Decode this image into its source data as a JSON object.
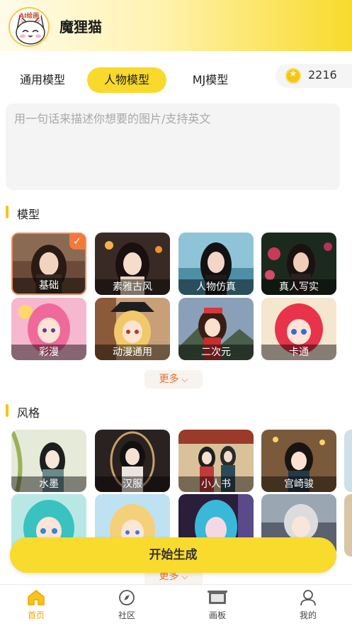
{
  "header": {
    "app_title": "魔狸猫",
    "logo_text": "AI绘画"
  },
  "tabs": [
    {
      "label": "通用模型",
      "active": false
    },
    {
      "label": "人物模型",
      "active": true
    },
    {
      "label": "MJ模型",
      "active": false
    }
  ],
  "coins": {
    "count": "2216"
  },
  "prompt": {
    "placeholder": "用一句话来描述你想要的图片/支持英文",
    "value": ""
  },
  "models_section": {
    "title": "模型",
    "items": [
      {
        "label": "基础",
        "selected": true
      },
      {
        "label": "素雅古风",
        "selected": false
      },
      {
        "label": "人物仿真",
        "selected": false
      },
      {
        "label": "真人写实",
        "selected": false
      },
      {
        "label": "彩漫",
        "selected": false
      },
      {
        "label": "动漫通用",
        "selected": false
      },
      {
        "label": "二次元",
        "selected": false
      },
      {
        "label": "卡通",
        "selected": false
      }
    ],
    "more_label": "更多"
  },
  "styles_section": {
    "title": "风格",
    "items": [
      {
        "label": "水墨"
      },
      {
        "label": "汉服"
      },
      {
        "label": "小人书"
      },
      {
        "label": "宫崎骏"
      },
      {
        "label": ""
      },
      {
        "label": ""
      },
      {
        "label": ""
      },
      {
        "label": ""
      }
    ],
    "more_label": "更多"
  },
  "start_button": {
    "label": "开始生成"
  },
  "bottom_nav": [
    {
      "label": "首页",
      "icon": "home-icon",
      "active": true
    },
    {
      "label": "社区",
      "icon": "compass-icon",
      "active": false
    },
    {
      "label": "画板",
      "icon": "canvas-board-icon",
      "active": false
    },
    {
      "label": "我的",
      "icon": "user-icon",
      "active": false
    }
  ],
  "colors": {
    "accent": "#f8db2c",
    "selection": "#f07a3c",
    "active_nav": "#f0a500"
  }
}
